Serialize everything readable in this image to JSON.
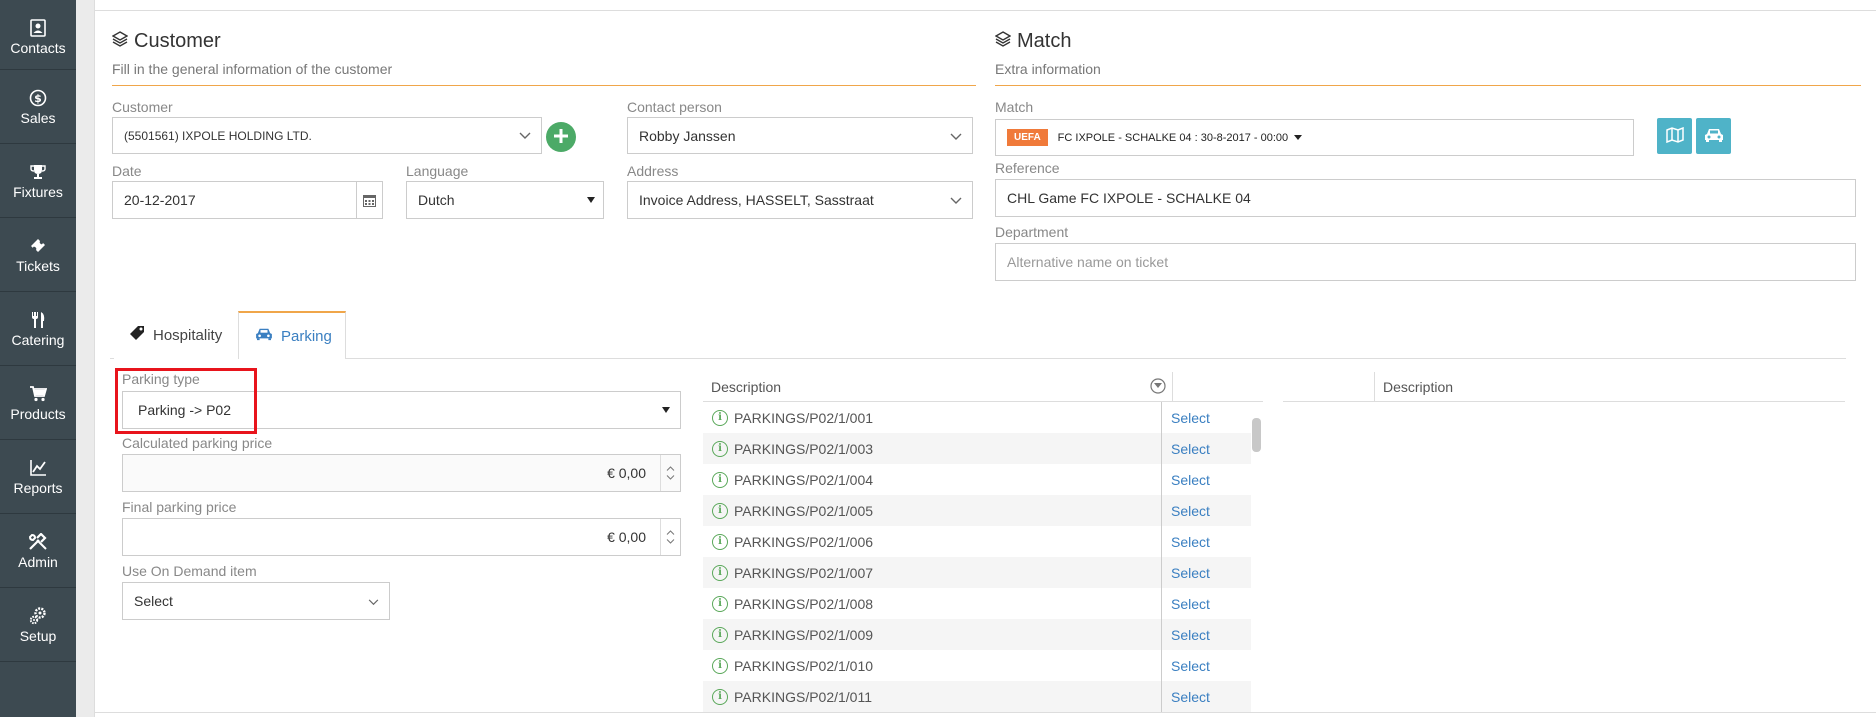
{
  "sidebar": {
    "items": [
      {
        "label": "Contacts",
        "icon": "contacts-icon"
      },
      {
        "label": "Sales",
        "icon": "dollar-icon"
      },
      {
        "label": "Fixtures",
        "icon": "trophy-icon"
      },
      {
        "label": "Tickets",
        "icon": "ticket-icon"
      },
      {
        "label": "Catering",
        "icon": "fork-knife-icon"
      },
      {
        "label": "Products",
        "icon": "cart-icon"
      },
      {
        "label": "Reports",
        "icon": "chart-icon"
      },
      {
        "label": "Admin",
        "icon": "tools-icon"
      },
      {
        "label": "Setup",
        "icon": "gears-icon"
      }
    ]
  },
  "customer": {
    "title": "Customer",
    "subtitle": "Fill in the general information of the customer",
    "customer_label": "Customer",
    "customer_value": "(5501561) IXPOLE HOLDING LTD.",
    "contact_label": "Contact person",
    "contact_value": "Robby Janssen",
    "date_label": "Date",
    "date_value": "20-12-2017",
    "language_label": "Language",
    "language_value": "Dutch",
    "address_label": "Address",
    "address_value": "Invoice Address, HASSELT, Sasstraat"
  },
  "match": {
    "title": "Match",
    "subtitle": "Extra information",
    "match_label": "Match",
    "badge": "UEFA",
    "match_value": "FC IXPOLE - SCHALKE 04 : 30-8-2017 - 00:00",
    "reference_label": "Reference",
    "reference_value": "CHL Game FC IXPOLE - SCHALKE 04",
    "department_label": "Department",
    "department_placeholder": "Alternative name on ticket"
  },
  "tabs": [
    {
      "label": "Hospitality"
    },
    {
      "label": "Parking"
    }
  ],
  "parking": {
    "type_label": "Parking type",
    "type_value": "Parking -> P02",
    "calc_label": "Calculated parking price",
    "calc_value": "€ 0,00",
    "final_label": "Final parking price",
    "final_value": "€ 0,00",
    "ondemand_label": "Use On Demand item",
    "ondemand_value": "Select"
  },
  "grid": {
    "header": "Description",
    "select_label": "Select",
    "rows": [
      "PARKINGS/P02/1/001",
      "PARKINGS/P02/1/003",
      "PARKINGS/P02/1/004",
      "PARKINGS/P02/1/005",
      "PARKINGS/P02/1/006",
      "PARKINGS/P02/1/007",
      "PARKINGS/P02/1/008",
      "PARKINGS/P02/1/009",
      "PARKINGS/P02/1/010",
      "PARKINGS/P02/1/011"
    ]
  },
  "grid2": {
    "header": "Description"
  }
}
